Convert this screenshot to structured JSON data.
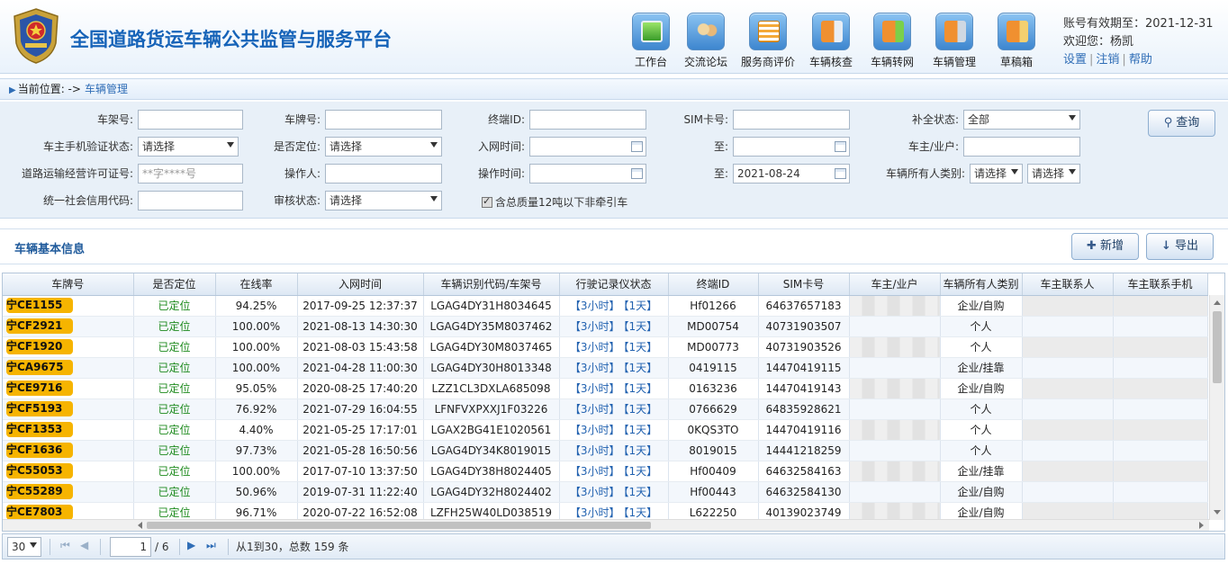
{
  "header": {
    "title": "全国道路货运车辆公共监管与服务平台",
    "tools": [
      {
        "label": "工作台",
        "icon": "monitor-icon"
      },
      {
        "label": "交流论坛",
        "icon": "forum-icon"
      },
      {
        "label": "服务商评价",
        "icon": "checklist-icon"
      },
      {
        "label": "车辆核查",
        "icon": "truck-search-icon"
      },
      {
        "label": "车辆转网",
        "icon": "truck-transfer-icon"
      },
      {
        "label": "车辆管理",
        "icon": "truck-gear-icon"
      },
      {
        "label": "草稿箱",
        "icon": "truck-draft-icon"
      }
    ],
    "account": {
      "expiry": "账号有效期至：2021-12-31",
      "welcome": "欢迎您：杨凯",
      "settings": "设置",
      "logout": "注销",
      "help": "帮助"
    }
  },
  "breadcrumb": {
    "prefix": "当前位置: ->",
    "current": "车辆管理"
  },
  "filter": {
    "frame_no": {
      "label": "车架号:",
      "value": ""
    },
    "plate_no": {
      "label": "车牌号:",
      "value": ""
    },
    "terminal_id": {
      "label": "终端ID:",
      "value": ""
    },
    "sim_no": {
      "label": "SIM卡号:",
      "value": ""
    },
    "makeup_status": {
      "label": "补全状态:",
      "value": "全部"
    },
    "phone_verify": {
      "label": "车主手机验证状态:",
      "value": "请选择"
    },
    "located": {
      "label": "是否定位:",
      "value": "请选择"
    },
    "join_time": {
      "label": "入网时间:",
      "value": ""
    },
    "join_to": {
      "label": "至:",
      "value": ""
    },
    "owner": {
      "label": "车主/业户:",
      "value": ""
    },
    "license_no": {
      "label": "道路运输经营许可证号:",
      "placeholder": "**字****号"
    },
    "operator": {
      "label": "操作人:",
      "value": ""
    },
    "op_time": {
      "label": "操作时间:",
      "value": ""
    },
    "op_to": {
      "label": "至:",
      "value": "2021-08-24"
    },
    "owner_type": {
      "label": "车辆所有人类别:",
      "value1": "请选择",
      "value2": "请选择"
    },
    "credit_code": {
      "label": "统一社会信用代码:",
      "value": ""
    },
    "audit_status": {
      "label": "审核状态:",
      "value": "请选择"
    },
    "weight_check": "含总质量12吨以下非牵引车",
    "query_label": "查询"
  },
  "section": {
    "title": "车辆基本信息",
    "add_label": "新增",
    "export_label": "导出"
  },
  "grid": {
    "columns": [
      "车牌号",
      "是否定位",
      "在线率",
      "入网时间",
      "车辆识别代码/车架号",
      "行驶记录仪状态",
      "终端ID",
      "SIM卡号",
      "车主/业户",
      "车辆所有人类别",
      "车主联系人",
      "车主联系手机"
    ],
    "rec_3h": "【3小时】",
    "rec_1d": "【1天】",
    "rows": [
      {
        "plate": "宁CE1155",
        "located": "已定位",
        "online": "94.25%",
        "join": "2017-09-25 12:37:37",
        "vin": "LGAG4DY31H8034645",
        "tid": "Hf01266",
        "sim": "64637657183",
        "type": "企业/自购"
      },
      {
        "plate": "宁CF2921",
        "located": "已定位",
        "online": "100.00%",
        "join": "2021-08-13 14:30:30",
        "vin": "LGAG4DY35M8037462",
        "tid": "MD00754",
        "sim": "40731903507",
        "type": "个人"
      },
      {
        "plate": "宁CF1920",
        "located": "已定位",
        "online": "100.00%",
        "join": "2021-08-03 15:43:58",
        "vin": "LGAG4DY30M8037465",
        "tid": "MD00773",
        "sim": "40731903526",
        "type": "个人"
      },
      {
        "plate": "宁CA9675",
        "located": "已定位",
        "online": "100.00%",
        "join": "2021-04-28 11:00:30",
        "vin": "LGAG4DY30H8013348",
        "tid": "0419115",
        "sim": "14470419115",
        "type": "企业/挂靠"
      },
      {
        "plate": "宁CE9716",
        "located": "已定位",
        "online": "95.05%",
        "join": "2020-08-25 17:40:20",
        "vin": "LZZ1CL3DXLA685098",
        "tid": "0163236",
        "sim": "14470419143",
        "type": "企业/自购"
      },
      {
        "plate": "宁CF5193",
        "located": "已定位",
        "online": "76.92%",
        "join": "2021-07-29 16:04:55",
        "vin": "LFNFVXPXXJ1F03226",
        "tid": "0766629",
        "sim": "64835928621",
        "type": "个人"
      },
      {
        "plate": "宁CF1353",
        "located": "已定位",
        "online": "4.40%",
        "join": "2021-05-25 17:17:01",
        "vin": "LGAX2BG41E1020561",
        "tid": "0KQS3TO",
        "sim": "14470419116",
        "type": "个人"
      },
      {
        "plate": "宁CF1636",
        "located": "已定位",
        "online": "97.73%",
        "join": "2021-05-28 16:50:56",
        "vin": "LGAG4DY34K8019015",
        "tid": "8019015",
        "sim": "14441218259",
        "type": "个人"
      },
      {
        "plate": "宁C55053",
        "located": "已定位",
        "online": "100.00%",
        "join": "2017-07-10 13:37:50",
        "vin": "LGAG4DY38H8024405",
        "tid": "Hf00409",
        "sim": "64632584163",
        "type": "企业/挂靠"
      },
      {
        "plate": "宁C55289",
        "located": "已定位",
        "online": "50.96%",
        "join": "2019-07-31 11:22:40",
        "vin": "LGAG4DY32H8024402",
        "tid": "Hf00443",
        "sim": "64632584130",
        "type": "企业/自购"
      },
      {
        "plate": "宁CE7803",
        "located": "已定位",
        "online": "96.71%",
        "join": "2020-07-22 16:52:08",
        "vin": "LZFH25W40LD038519",
        "tid": "L622250",
        "sim": "40139023749",
        "type": "企业/自购"
      }
    ]
  },
  "pager": {
    "page_size": "30",
    "current_page": "1",
    "total_pages": "/ 6",
    "summary": "从1到30，总数 159 条"
  }
}
